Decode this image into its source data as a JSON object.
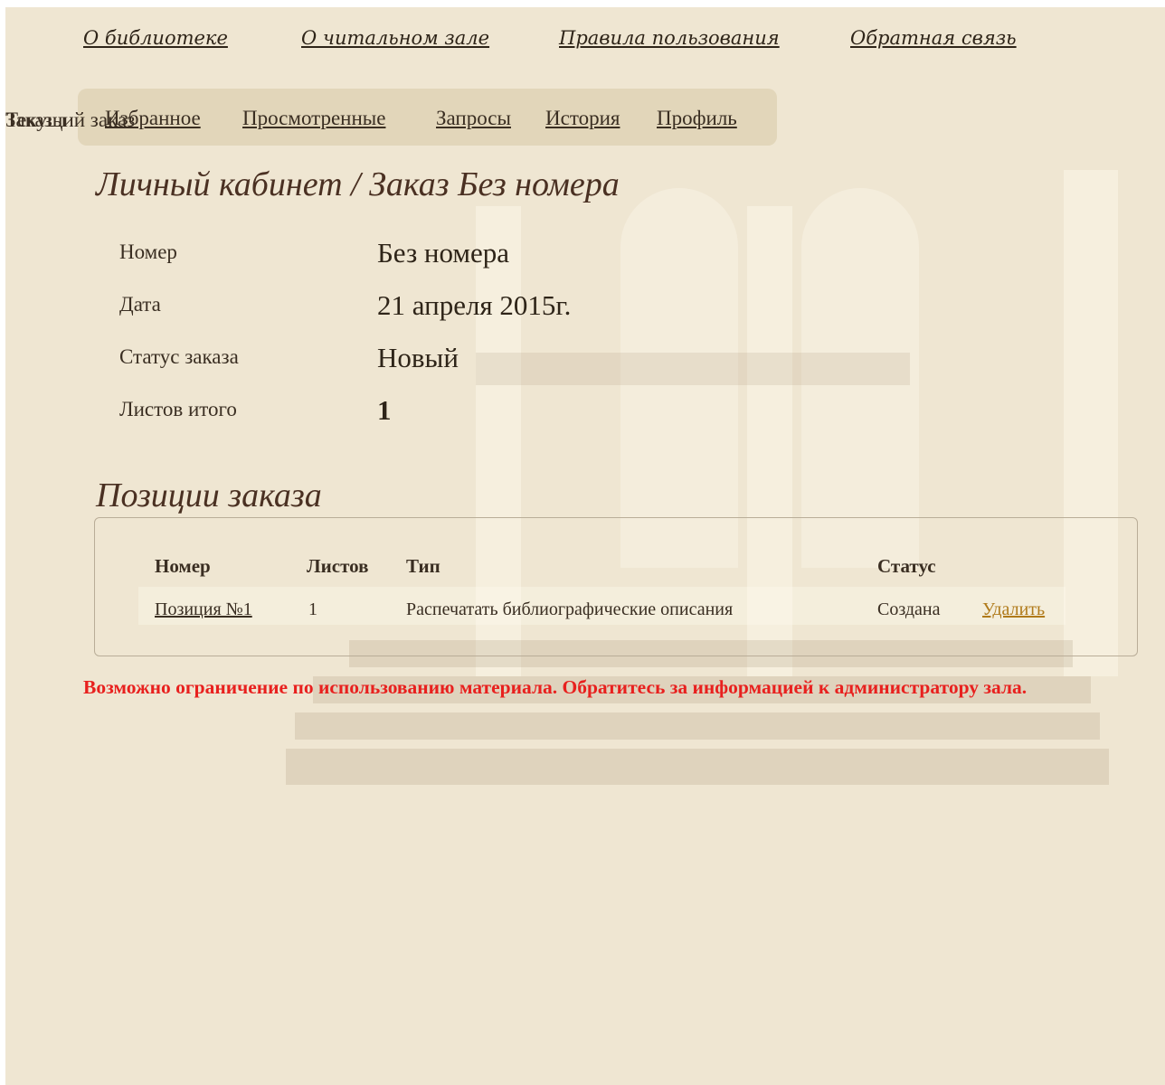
{
  "top_links": [
    "О библиотеке",
    "О читальном зале",
    "Правила пользования",
    "Обратная связь"
  ],
  "subnav": [
    "Избранное",
    "Просмотренные",
    "Запросы",
    "История",
    "Профиль"
  ],
  "right_nav": {
    "orders": "Заказы",
    "current_order": "Текущий заказ"
  },
  "page_title": "Личный кабинет / Заказ Без номера",
  "order_info": [
    {
      "label": "Номер",
      "value": "Без номера"
    },
    {
      "label": "Дата",
      "value": "21 апреля 2015г."
    },
    {
      "label": "Статус заказа",
      "value": "Новый"
    },
    {
      "label": "Листов итого",
      "value": "1"
    }
  ],
  "positions": {
    "title": "Позиции заказа",
    "headers": {
      "number": "Номер",
      "sheets": "Листов",
      "type": "Тип",
      "status": "Статус"
    },
    "rows": [
      {
        "number": "Позиция №1",
        "sheets": "1",
        "type": "Распечатать библиографические описания",
        "status": "Создана",
        "action": "Удалить"
      }
    ]
  },
  "warning": "Возможно ограничение по использованию материала. Обратитесь за информацией к администратору зала.",
  "colors": {
    "background": "#efe6d2",
    "warning": "#e8201e",
    "link_active": "#8a4a10"
  }
}
